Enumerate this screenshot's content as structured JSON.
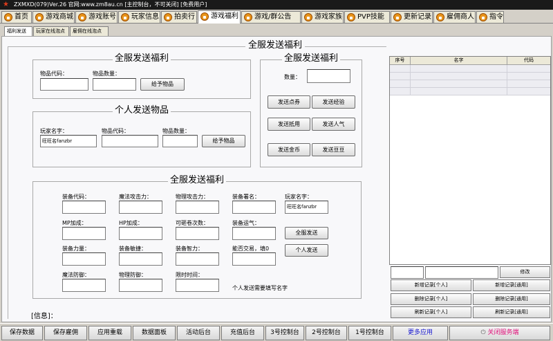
{
  "window": {
    "title": "ZXMXD(079)Ver.26 官网:www.zm8au.cn   [主控制台，不可关闭]  [免费用户]"
  },
  "tabs": [
    {
      "label": "首页",
      "active": false
    },
    {
      "label": "游戏商城",
      "active": false
    },
    {
      "label": "游戏账号",
      "active": false
    },
    {
      "label": "玩家信息",
      "active": false
    },
    {
      "label": "拍卖行",
      "active": false
    },
    {
      "label": "游戏福利",
      "active": true
    },
    {
      "label": "游戏/群公告",
      "active": false
    },
    {
      "label": "游戏家族",
      "active": false
    },
    {
      "label": "PVP技能",
      "active": false
    },
    {
      "label": "更新记录",
      "active": false
    },
    {
      "label": "雇佣商人",
      "active": false
    },
    {
      "label": "指令",
      "active": false
    }
  ],
  "subtabs": [
    {
      "label": "福利发送",
      "active": true
    },
    {
      "label": "玩家在线泡点",
      "active": false
    },
    {
      "label": "雇佣在线泡点",
      "active": false
    }
  ],
  "main_title": "全服发送福利",
  "group_server_items": {
    "title": "全服发送福利",
    "item_code_label": "物品代码：",
    "item_qty_label": "物品数量：",
    "item_code_value": "",
    "item_qty_value": "",
    "give_button": "给予物品"
  },
  "group_personal_items": {
    "title": "个人发送物品",
    "player_name_label": "玩家名字：",
    "player_name_value": "旺旺名fanzbr",
    "item_code_label": "物品代码：",
    "item_qty_label": "物品数量：",
    "give_button": "给予物品"
  },
  "group_server_rewards": {
    "title": "全服发送福利",
    "qty_label": "数量：",
    "qty_value": "",
    "buttons": [
      "发送点券",
      "发送经验",
      "发送抵用",
      "发送人气",
      "发送金币",
      "发送豆豆"
    ]
  },
  "group_equipment": {
    "title": "全服发送福利",
    "labels": {
      "equip_code": "装备代码：",
      "magic_atk": "魔法攻击力：",
      "phys_atk": "物理攻击力：",
      "equip_sign": "装备署名：",
      "player_name": "玩家名字：",
      "mp": "MP加成：",
      "hp": "HP加成：",
      "scroll_times": "可砸卷次数：",
      "luck": "装备运气：",
      "str": "装备力量：",
      "agi": "装备敏捷：",
      "int": "装备智力：",
      "tradable": "能否交易，填0",
      "magic_def": "魔法防御：",
      "phys_def": "物理防御：",
      "time_limit": "限时时间："
    },
    "player_name_value": "旺旺名fanzbr",
    "server_send_button": "全服发送",
    "personal_send_button": "个人发送",
    "note": "个人发送需要填写名字"
  },
  "info_label": "[信息]：",
  "records_table": {
    "headers": [
      "序号",
      "名字",
      "代码"
    ],
    "rows": 4
  },
  "records_controls": {
    "edit_button": "修改",
    "buttons": [
      "新增记录[个人]",
      "新增记录[通用]",
      "删除记录[个人]",
      "删除记录[通用]",
      "刷新记录[个人]",
      "刷新记录[通用]"
    ]
  },
  "bottom_bar": {
    "buttons": [
      "保存数据",
      "保存雇佣",
      "应用重载",
      "数据面板",
      "活动后台",
      "充值后台",
      "3号控制台",
      "2号控制台",
      "1号控制台",
      "更多应用"
    ],
    "close_service": "关闭服务端",
    "more_apps_color": "#1818d0",
    "close_color": "#e0107a"
  },
  "colors": {
    "accent_icon": "#e8941a",
    "titlebar": "#1a1a1a"
  }
}
